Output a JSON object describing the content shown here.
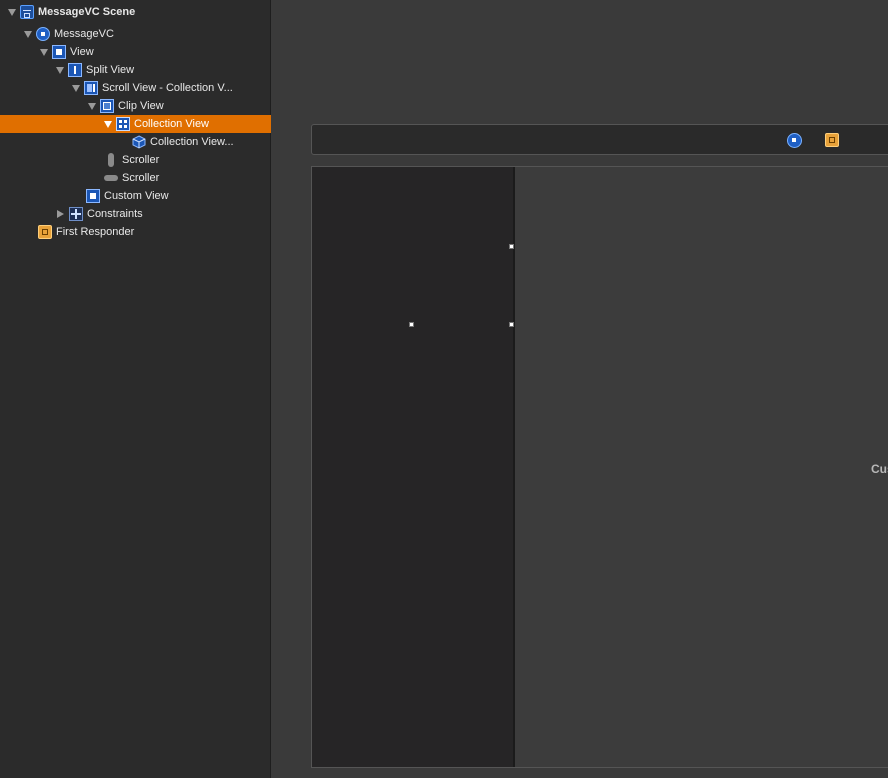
{
  "outline": {
    "items": [
      {
        "label": "MessageVC Scene"
      },
      {
        "label": "MessageVC"
      },
      {
        "label": "View"
      },
      {
        "label": "Split View"
      },
      {
        "label": "Scroll View - Collection V..."
      },
      {
        "label": "Clip View"
      },
      {
        "label": "Collection View"
      },
      {
        "label": "Collection View..."
      },
      {
        "label": "Scroller"
      },
      {
        "label": "Scroller"
      },
      {
        "label": "Custom View"
      },
      {
        "label": "Constraints"
      },
      {
        "label": "First Responder"
      }
    ]
  },
  "canvas": {
    "custom_view_label": "Cus"
  },
  "colors": {
    "selection": "#e06f00",
    "outline_bg": "#2b2b2b",
    "canvas_bg": "#3a3a3a",
    "left_pane_bg": "#262526"
  }
}
